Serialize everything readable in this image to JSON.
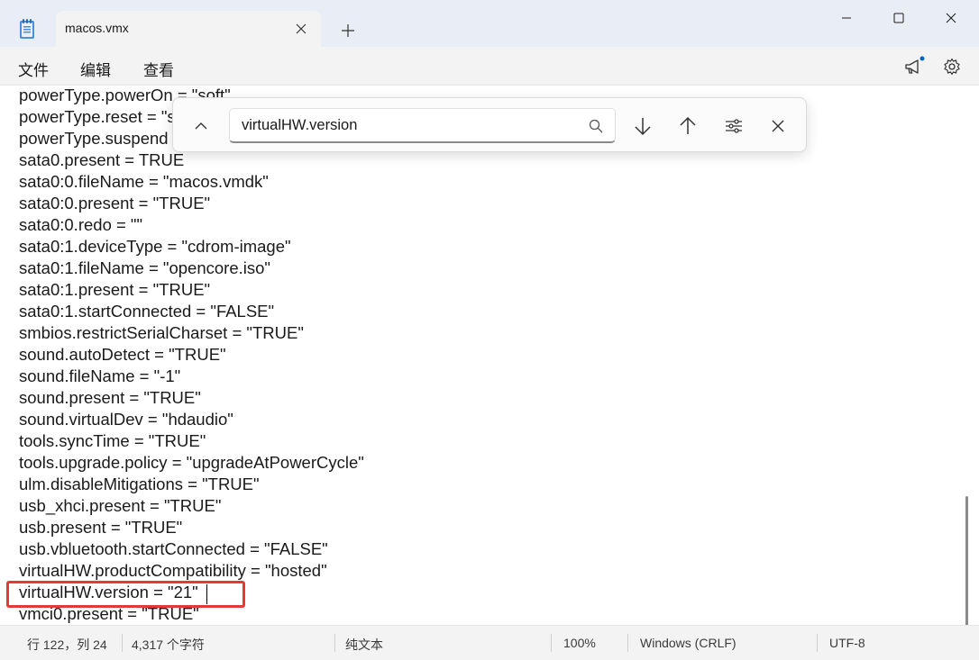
{
  "window": {
    "tab_title": "macos.vmx"
  },
  "menu": {
    "items": [
      "文件",
      "编辑",
      "查看"
    ]
  },
  "find": {
    "query": "virtualHW.version"
  },
  "editor": {
    "lines": [
      "powerType.powerOn = \"soft\"",
      "powerType.reset = \"soft\"",
      "powerType.suspend = \"soft\"",
      "sata0.present = TRUE",
      "sata0:0.fileName = \"macos.vmdk\"",
      "sata0:0.present = \"TRUE\"",
      "sata0:0.redo = \"\"",
      "sata0:1.deviceType = \"cdrom-image\"",
      "sata0:1.fileName = \"opencore.iso\"",
      "sata0:1.present = \"TRUE\"",
      "sata0:1.startConnected = \"FALSE\"",
      "smbios.restrictSerialCharset = \"TRUE\"",
      "sound.autoDetect = \"TRUE\"",
      "sound.fileName = \"-1\"",
      "sound.present = \"TRUE\"",
      "sound.virtualDev = \"hdaudio\"",
      "tools.syncTime = \"TRUE\"",
      "tools.upgrade.policy = \"upgradeAtPowerCycle\"",
      "ulm.disableMitigations = \"TRUE\"",
      "usb_xhci.present = \"TRUE\"",
      "usb.present = \"TRUE\"",
      "usb.vbluetooth.startConnected = \"FALSE\"",
      "virtualHW.productCompatibility = \"hosted\"",
      "virtualHW.version = \"21\"",
      "vmci0.present = \"TRUE\""
    ],
    "highlight_color": "#e53935"
  },
  "status": {
    "position": "行 122，列 24",
    "char_count": "4,317 个字符",
    "format": "纯文本",
    "zoom": "100%",
    "line_ending": "Windows (CRLF)",
    "encoding": "UTF-8"
  },
  "colors": {
    "titlebar_bg": "#e9eef6",
    "body_bg": "#f3f3f3",
    "editor_bg": "#ffffff",
    "notification_dot": "#0067c0"
  }
}
